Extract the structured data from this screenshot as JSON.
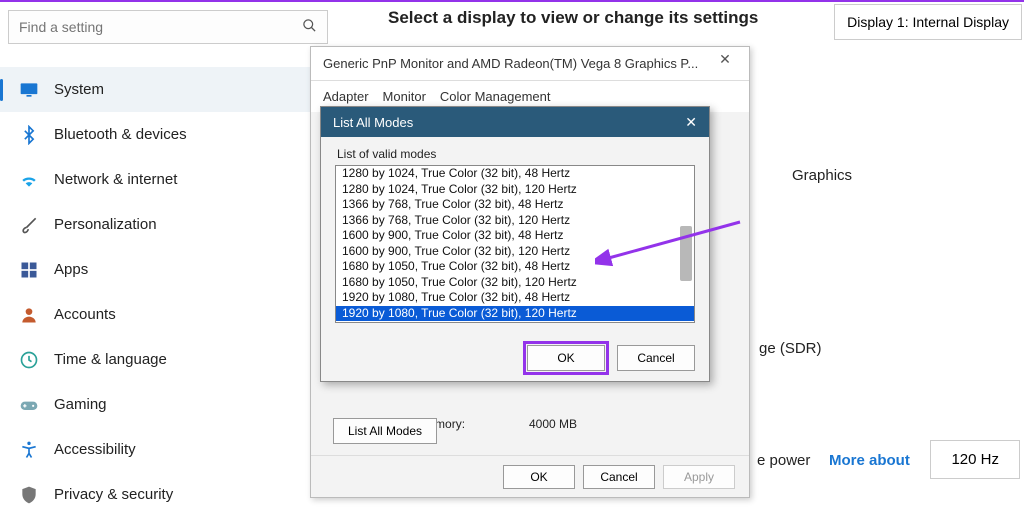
{
  "search": {
    "placeholder": "Find a setting"
  },
  "sidebar": {
    "items": [
      {
        "label": "System",
        "icon": "monitor",
        "color": "#1976d2",
        "active": true
      },
      {
        "label": "Bluetooth & devices",
        "icon": "bluetooth",
        "color": "#1976d2"
      },
      {
        "label": "Network & internet",
        "icon": "wifi",
        "color": "#1aa3e8"
      },
      {
        "label": "Personalization",
        "icon": "brush",
        "color": "#555"
      },
      {
        "label": "Apps",
        "icon": "apps",
        "color": "#3b5998"
      },
      {
        "label": "Accounts",
        "icon": "person",
        "color": "#c45b2e"
      },
      {
        "label": "Time & language",
        "icon": "clock",
        "color": "#2aa198"
      },
      {
        "label": "Gaming",
        "icon": "gamepad",
        "color": "#7ba8b3"
      },
      {
        "label": "Accessibility",
        "icon": "accessibility",
        "color": "#1976d2"
      },
      {
        "label": "Privacy & security",
        "icon": "shield",
        "color": "#777"
      }
    ]
  },
  "main": {
    "heading": "Select a display to view or change its settings",
    "display_button": "Display 1: Internal Display",
    "graphics_label": "Graphics",
    "sdr_label": "ge (SDR)",
    "power_label": "e power",
    "more_about": "More about",
    "refresh_rate": "120 Hz"
  },
  "props_dialog": {
    "title": "Generic PnP Monitor and AMD Radeon(TM) Vega 8 Graphics P...",
    "tabs": [
      "Adapter",
      "Monitor",
      "Color Management"
    ],
    "shared_mem_label": "Shared System Memory:",
    "shared_mem_value": "4000 MB",
    "list_all_modes_btn": "List All Modes",
    "ok": "OK",
    "cancel": "Cancel",
    "apply": "Apply"
  },
  "modes_dialog": {
    "title": "List All Modes",
    "list_label": "List of valid modes",
    "rows": [
      "1280 by 1024, True Color (32 bit), 48 Hertz",
      "1280 by 1024, True Color (32 bit), 120 Hertz",
      "1366 by 768, True Color (32 bit), 48 Hertz",
      "1366 by 768, True Color (32 bit), 120 Hertz",
      "1600 by 900, True Color (32 bit), 48 Hertz",
      "1600 by 900, True Color (32 bit), 120 Hertz",
      "1680 by 1050, True Color (32 bit), 48 Hertz",
      "1680 by 1050, True Color (32 bit), 120 Hertz",
      "1920 by 1080, True Color (32 bit), 48 Hertz",
      "1920 by 1080, True Color (32 bit), 120 Hertz"
    ],
    "selected_index": 9,
    "ok": "OK",
    "cancel": "Cancel"
  }
}
